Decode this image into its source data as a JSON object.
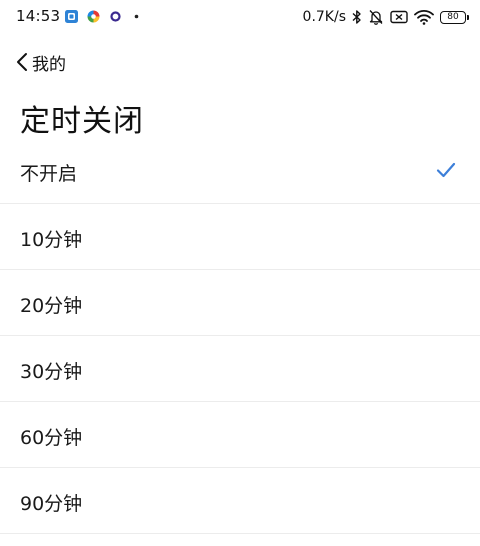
{
  "status_bar": {
    "time": "14:53",
    "net_speed": "0.7K/s",
    "battery": "80",
    "app_icons": [
      "blue-square-app-icon",
      "colorful-pinwheel-app-icon",
      "purple-ring-app-icon"
    ],
    "status_icons": [
      "bluetooth-icon",
      "bell-muted-icon",
      "sim-disabled-icon",
      "wifi-icon",
      "battery-icon"
    ]
  },
  "nav": {
    "back_label": "我的"
  },
  "page": {
    "title": "定时关闭"
  },
  "options": [
    {
      "label": "不开启",
      "selected": true
    },
    {
      "label": "10分钟",
      "selected": false
    },
    {
      "label": "20分钟",
      "selected": false
    },
    {
      "label": "30分钟",
      "selected": false
    },
    {
      "label": "60分钟",
      "selected": false
    },
    {
      "label": "90分钟",
      "selected": false
    }
  ],
  "colors": {
    "accent": "#3d7fd9",
    "divider": "#ececec",
    "text": "#1a1a1a"
  }
}
